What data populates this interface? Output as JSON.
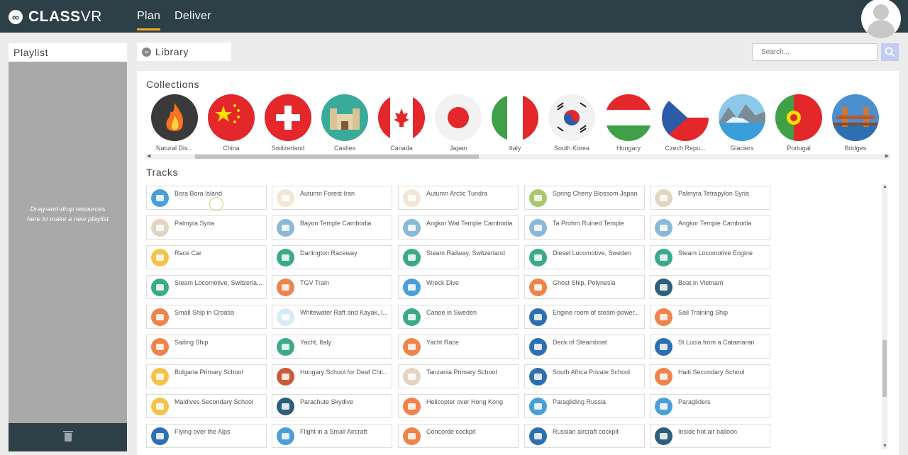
{
  "app": {
    "brand_bold": "CLASS",
    "brand_thin": "VR"
  },
  "nav": {
    "plan": "Plan",
    "deliver": "Deliver"
  },
  "playlist": {
    "title": "Playlist",
    "hint_line1": "Drag-and-drop resources",
    "hint_line2": "here to make a new playlist"
  },
  "library": {
    "title": "Library"
  },
  "search": {
    "placeholder": "Search..."
  },
  "collections_title": "Collections",
  "tracks_title": "Tracks",
  "collections": [
    {
      "label": "Natural Dis...",
      "icon": "fire-icon"
    },
    {
      "label": "China",
      "icon": "china-flag-icon"
    },
    {
      "label": "Switzerland",
      "icon": "switzerland-flag-icon"
    },
    {
      "label": "Castles",
      "icon": "castle-icon"
    },
    {
      "label": "Canada",
      "icon": "canada-flag-icon"
    },
    {
      "label": "Japan",
      "icon": "japan-flag-icon"
    },
    {
      "label": "Italy",
      "icon": "italy-flag-icon"
    },
    {
      "label": "South Korea",
      "icon": "south-korea-flag-icon"
    },
    {
      "label": "Hungary",
      "icon": "hungary-flag-icon"
    },
    {
      "label": "Czech Repu...",
      "icon": "czech-flag-icon"
    },
    {
      "label": "Glaciers",
      "icon": "glacier-icon"
    },
    {
      "label": "Portugal",
      "icon": "portugal-flag-icon"
    },
    {
      "label": "Bridges",
      "icon": "bridge-icon"
    }
  ],
  "tracks": [
    {
      "label": "Bora Bora Island",
      "color": "#4a9fd8",
      "icon": "island-icon"
    },
    {
      "label": "Autumn Forest Iran",
      "color": "#f3e6d6",
      "icon": "leaf-icon"
    },
    {
      "label": "Autumn Arctic Tundra",
      "color": "#f3e6d6",
      "icon": "leaf-icon"
    },
    {
      "label": "Spring Cherry Blossom Japan",
      "color": "#a8c96a",
      "icon": "blossom-icon"
    },
    {
      "label": "Palmyra Tetrapylon Syria",
      "color": "#e2d6c2",
      "icon": "ruins-icon"
    },
    {
      "label": "Palmyra Syria",
      "color": "#e2d6c2",
      "icon": "ruins-icon"
    },
    {
      "label": "Bayon Temple Cambodia",
      "color": "#8ab8d8",
      "icon": "temple-icon"
    },
    {
      "label": "Angkor Wat Temple Cambodia",
      "color": "#8ab8d8",
      "icon": "temple-icon"
    },
    {
      "label": "Ta Prohm Ruined Temple",
      "color": "#8ab8d8",
      "icon": "temple-icon"
    },
    {
      "label": "Angkor Temple Cambodia",
      "color": "#8ab8d8",
      "icon": "temple-icon"
    },
    {
      "label": "Race Car",
      "color": "#f5c24a",
      "icon": "car-icon"
    },
    {
      "label": "Darlington Raceway",
      "color": "#3aaa8a",
      "icon": "car-icon"
    },
    {
      "label": "Steam Railway, Switzerland",
      "color": "#3aaa8a",
      "icon": "train-icon"
    },
    {
      "label": "Diesel Locomotive, Sweden",
      "color": "#3aaa8a",
      "icon": "train-icon"
    },
    {
      "label": "Steam Locomotive Engine",
      "color": "#3aaa8a",
      "icon": "train-icon"
    },
    {
      "label": "Steam Locomotive, Switzerla...",
      "color": "#3aaa8a",
      "icon": "train-icon"
    },
    {
      "label": "TGV Train",
      "color": "#f0834a",
      "icon": "train-icon"
    },
    {
      "label": "Wreck Dive",
      "color": "#4a9fd8",
      "icon": "flippers-icon"
    },
    {
      "label": "Ghost Ship, Polynesia",
      "color": "#f0834a",
      "icon": "ship-icon"
    },
    {
      "label": "Boat in Vietnam",
      "color": "#2d5f7a",
      "icon": "boat-icon"
    },
    {
      "label": "Small Ship in Croatia",
      "color": "#f0834a",
      "icon": "ship-icon"
    },
    {
      "label": "Whitewater Raft and Kayak, I...",
      "color": "#d9eaf5",
      "icon": "kayak-icon"
    },
    {
      "label": "Canoe in Sweden",
      "color": "#3aaa8a",
      "icon": "paddle-icon"
    },
    {
      "label": "Engine room of steam-power...",
      "color": "#2d6fb0",
      "icon": "ship-icon"
    },
    {
      "label": "Sail Training Ship",
      "color": "#f0834a",
      "icon": "anchor-icon"
    },
    {
      "label": "Sailing Ship",
      "color": "#f0834a",
      "icon": "sailboat-icon"
    },
    {
      "label": "Yacht, Italy",
      "color": "#3aaa8a",
      "icon": "sailboat-icon"
    },
    {
      "label": "Yacht Race",
      "color": "#f0834a",
      "icon": "sailboat-icon"
    },
    {
      "label": "Deck of Steamboat",
      "color": "#2d6fb0",
      "icon": "ship-icon"
    },
    {
      "label": "St Lucia from a Catamaran",
      "color": "#2d6fb0",
      "icon": "ship-icon"
    },
    {
      "label": "Bulgaria Primary School",
      "color": "#f5c24a",
      "icon": "books-icon"
    },
    {
      "label": "Hungary School for Deaf Chil...",
      "color": "#c85a3a",
      "icon": "school-icon"
    },
    {
      "label": "Tanzania Primary School",
      "color": "#e2d6c2",
      "icon": "apple-books-icon"
    },
    {
      "label": "South Africa Private School",
      "color": "#2d6fb0",
      "icon": "school-icon"
    },
    {
      "label": "Haiti Secondary School",
      "color": "#f0834a",
      "icon": "teacher-icon"
    },
    {
      "label": "Maldives Secondary School",
      "color": "#f5c24a",
      "icon": "graduation-cap-icon"
    },
    {
      "label": "Parachute Skydive",
      "color": "#2d5f7a",
      "icon": "goggles-icon"
    },
    {
      "label": "Helicopter over Hong Kong",
      "color": "#f0834a",
      "icon": "helicopter-icon"
    },
    {
      "label": "Paragliding Russia",
      "color": "#4a9fd8",
      "icon": "paraglider-icon"
    },
    {
      "label": "Paragliders",
      "color": "#4a9fd8",
      "icon": "paraglider-icon"
    },
    {
      "label": "Flying over the Alps",
      "color": "#2d6fb0",
      "icon": "plane-icon"
    },
    {
      "label": "Flight in a Small Aircraft",
      "color": "#4a9fd8",
      "icon": "plane-icon"
    },
    {
      "label": "Concorde cockpit",
      "color": "#f0834a",
      "icon": "plane-icon"
    },
    {
      "label": "Russian aircraft cockpit",
      "color": "#2d6fb0",
      "icon": "plane-icon"
    },
    {
      "label": "Inside hot air balloon",
      "color": "#2d5f7a",
      "icon": "balloon-icon"
    }
  ]
}
